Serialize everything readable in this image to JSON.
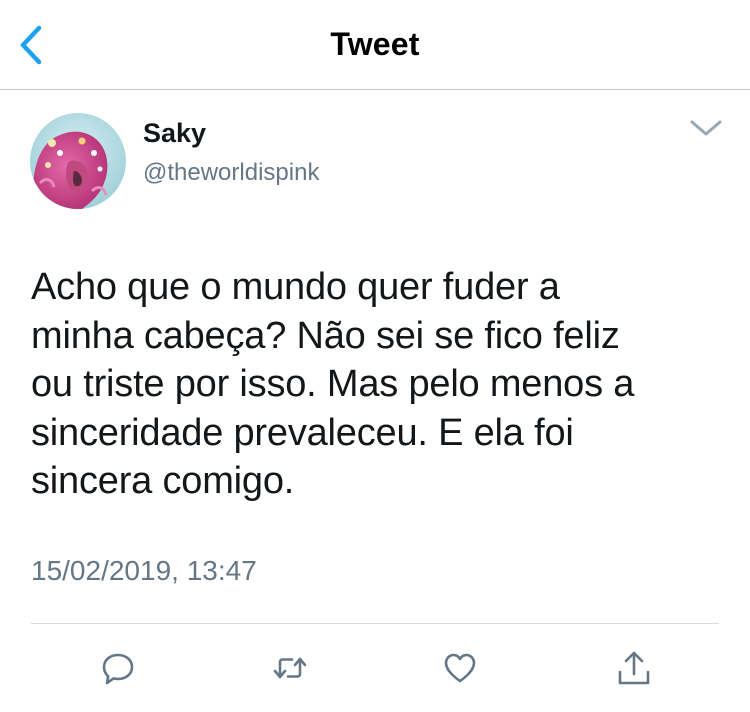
{
  "nav": {
    "title": "Tweet",
    "back_icon": "chevron-left-icon"
  },
  "author": {
    "display_name": "Saky",
    "handle": "@theworldispink",
    "avatar_icon": "avatar-photo"
  },
  "tweet": {
    "text": "Acho que o mundo quer fuder a\nminha cabeça? Não sei se fico feliz\nou triste por isso. Mas pelo menos a\nsinceridade prevaleceu. E ela foi\nsincera comigo.",
    "timestamp": "15/02/2019, 13:47"
  },
  "actions": [
    {
      "icon": "reply-icon"
    },
    {
      "icon": "retweet-icon"
    },
    {
      "icon": "like-icon"
    },
    {
      "icon": "share-icon"
    }
  ],
  "colors": {
    "accent": "#1da1f2",
    "secondary_text": "#657786",
    "icon_gray": "#657786"
  }
}
